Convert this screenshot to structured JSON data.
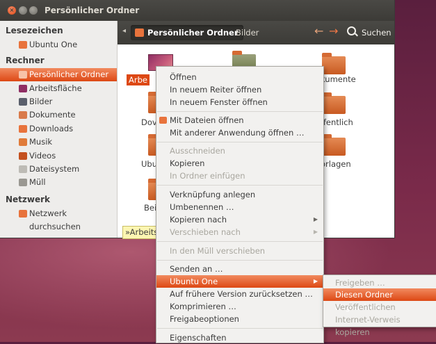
{
  "window": {
    "title": "Persönlicher Ordner"
  },
  "sidebar": {
    "sections": [
      {
        "heading": "Lesezeichen",
        "items": [
          {
            "label": "Ubuntu One",
            "icon": "folder-icon"
          }
        ]
      },
      {
        "heading": "Rechner",
        "items": [
          {
            "label": "Persönlicher Ordner",
            "icon": "home-folder-icon",
            "selected": true
          },
          {
            "label": "Arbeitsfläche",
            "icon": "desktop-icon"
          },
          {
            "label": "Bilder",
            "icon": "pictures-icon"
          },
          {
            "label": "Dokumente",
            "icon": "documents-icon"
          },
          {
            "label": "Downloads",
            "icon": "downloads-icon"
          },
          {
            "label": "Musik",
            "icon": "music-icon"
          },
          {
            "label": "Videos",
            "icon": "videos-icon"
          },
          {
            "label": "Dateisystem",
            "icon": "drive-icon"
          },
          {
            "label": "Müll",
            "icon": "trash-icon"
          }
        ]
      },
      {
        "heading": "Netzwerk",
        "items": [
          {
            "label": "Netzwerk durchsuchen",
            "icon": "network-icon"
          }
        ]
      }
    ]
  },
  "toolbar": {
    "path_active": "Persönlicher Ordner",
    "path_next": "Bilder",
    "search_label": "Suchen"
  },
  "content": {
    "items": [
      {
        "label": "Arbe",
        "selected": true
      },
      {
        "label": ""
      },
      {
        "label": "kumente"
      },
      {
        "label": "Dov"
      },
      {
        "label": "ffentlich"
      },
      {
        "label": "Ubu"
      },
      {
        "label": "orlagen"
      },
      {
        "label": "Bei"
      }
    ],
    "tooltip": "»Arbeits"
  },
  "context_menu": {
    "items": [
      {
        "label": "Öffnen"
      },
      {
        "label": "In neuem Reiter öffnen"
      },
      {
        "label": "In neuem Fenster öffnen"
      },
      {
        "separator": true
      },
      {
        "label": "Mit Dateien öffnen",
        "icon": "files-app-icon"
      },
      {
        "label": "Mit anderer Anwendung öffnen …"
      },
      {
        "separator": true
      },
      {
        "label": "Ausschneiden",
        "disabled": true
      },
      {
        "label": "Kopieren"
      },
      {
        "label": "In Ordner einfügen",
        "disabled": true
      },
      {
        "separator": true
      },
      {
        "label": "Verknüpfung anlegen"
      },
      {
        "label": "Umbenennen …"
      },
      {
        "label": "Kopieren nach",
        "submenu": true
      },
      {
        "label": "Verschieben nach",
        "submenu": true,
        "disabled": true
      },
      {
        "separator": true
      },
      {
        "label": "In den Müll verschieben",
        "disabled": true
      },
      {
        "separator": true
      },
      {
        "label": "Senden an …"
      },
      {
        "label": "Ubuntu One",
        "submenu": true,
        "highlighted": true
      },
      {
        "label": "Auf frühere Version zurücksetzen …"
      },
      {
        "label": "Komprimieren …"
      },
      {
        "label": "Freigabeoptionen"
      },
      {
        "separator": true
      },
      {
        "label": "Eigenschaften"
      }
    ]
  },
  "submenu": {
    "items": [
      {
        "label": "Freigeben …",
        "disabled": true
      },
      {
        "label": "Diesen Ordner abgleichen",
        "highlighted": true
      },
      {
        "label": "Veröffentlichen",
        "disabled": true
      },
      {
        "label": "Internet-Verweis kopieren",
        "disabled": true
      }
    ]
  },
  "colors": {
    "accent": "#dd4814",
    "chrome": "#3c3b37"
  }
}
